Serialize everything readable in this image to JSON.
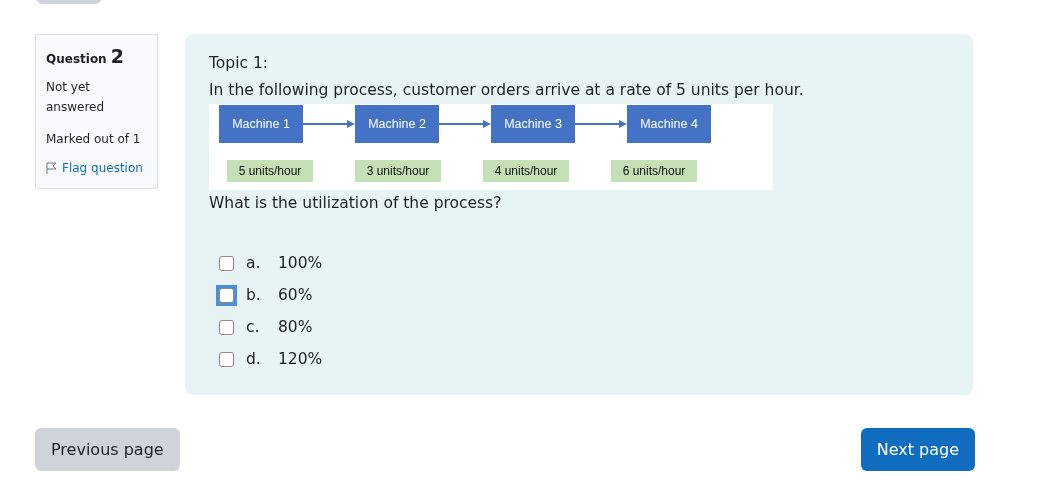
{
  "question_info": {
    "label": "Question",
    "number": "2",
    "status": "Not yet answered",
    "marks": "Marked out of 1",
    "flag": {
      "label": "Flag question",
      "flagged": false
    }
  },
  "question": {
    "topic": "Topic 1:",
    "text": "In the following process, customer orders arrive at a rate of 5 units per hour.",
    "diagram": {
      "machines": [
        {
          "name": "Machine 1",
          "rate": "5 units/hour"
        },
        {
          "name": "Machine 2",
          "rate": "3 units/hour"
        },
        {
          "name": "Machine 3",
          "rate": "4 units/hour"
        },
        {
          "name": "Machine 4",
          "rate": "6 units/hour"
        }
      ]
    },
    "prompt": "What is the utilization of the process?",
    "options": [
      {
        "letter": "a.",
        "text": "100%",
        "checked": false,
        "focused": false
      },
      {
        "letter": "b.",
        "text": "60%",
        "checked": false,
        "focused": true
      },
      {
        "letter": "c.",
        "text": "80%",
        "checked": false,
        "focused": false
      },
      {
        "letter": "d.",
        "text": "120%",
        "checked": false,
        "focused": false
      }
    ]
  },
  "navigation": {
    "previous": "Previous page",
    "next": "Next page"
  }
}
